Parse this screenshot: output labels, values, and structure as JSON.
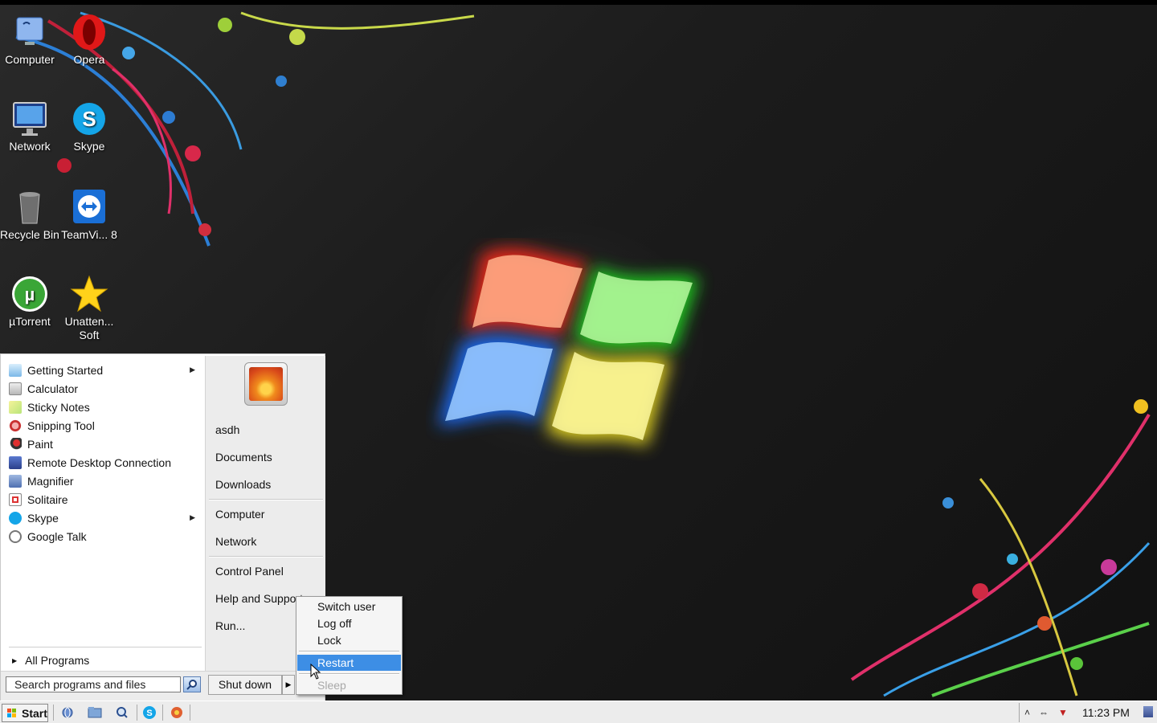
{
  "desktop": {
    "icons": [
      {
        "label": "Computer"
      },
      {
        "label": "Opera"
      },
      {
        "label": "Network"
      },
      {
        "label": "Skype"
      },
      {
        "label": "Recycle Bin"
      },
      {
        "label": "TeamVi... 8"
      },
      {
        "label": "µTorrent"
      },
      {
        "label": "Unatten... Soft"
      }
    ]
  },
  "start_menu": {
    "programs": [
      {
        "label": "Getting Started",
        "has_submenu": true
      },
      {
        "label": "Calculator"
      },
      {
        "label": "Sticky Notes"
      },
      {
        "label": "Snipping Tool"
      },
      {
        "label": "Paint"
      },
      {
        "label": "Remote Desktop Connection"
      },
      {
        "label": "Magnifier"
      },
      {
        "label": "Solitaire"
      },
      {
        "label": "Skype",
        "has_submenu": true
      },
      {
        "label": "Google Talk"
      }
    ],
    "all_programs": "All Programs",
    "right_pane": {
      "user": "asdh",
      "documents": "Documents",
      "downloads": "Downloads",
      "computer": "Computer",
      "network": "Network",
      "control_panel": "Control Panel",
      "help": "Help and Support",
      "run": "Run..."
    },
    "search_placeholder": "Search programs and files",
    "shutdown": "Shut down",
    "power_menu": {
      "switch_user": "Switch user",
      "log_off": "Log off",
      "lock": "Lock",
      "restart": "Restart",
      "sleep": "Sleep"
    }
  },
  "taskbar": {
    "start": "Start",
    "clock": "11:23 PM"
  },
  "colors": {
    "highlight": "#3d8ee5",
    "menu_bg": "#ffffff",
    "taskbar_bg": "#ececec"
  }
}
